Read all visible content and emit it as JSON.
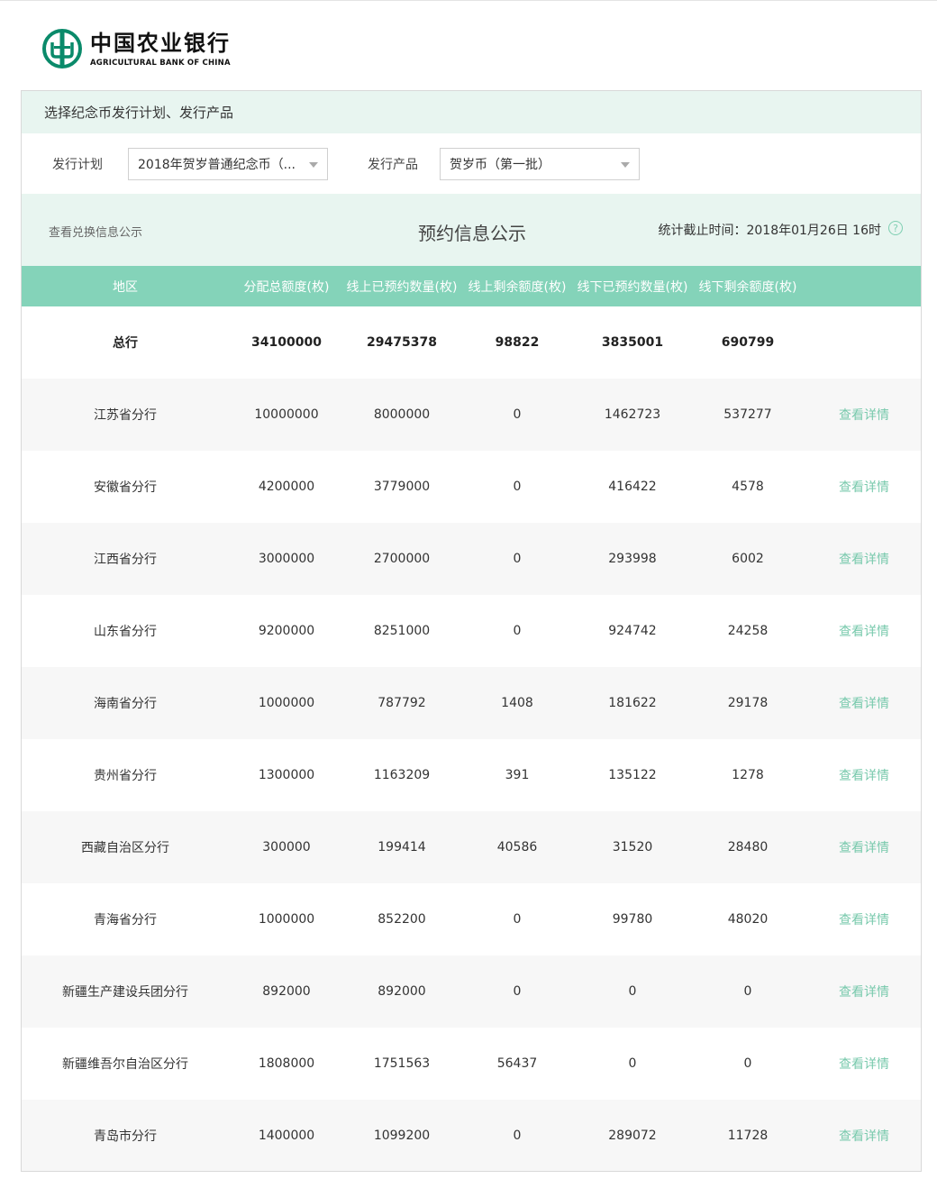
{
  "header": {
    "bank_name_cn": "中国农业银行",
    "bank_name_en": "AGRICULTURAL BANK OF CHINA",
    "brand_color": "#0a8a6a"
  },
  "panel": {
    "title": "选择纪念币发行计划、发行产品",
    "filters": {
      "plan_label": "发行计划",
      "plan_value": "2018年贺岁普通纪念币（...",
      "product_label": "发行产品",
      "product_value": "贺岁币（第一批）"
    },
    "info": {
      "exchange_link": "查看兑换信息公示",
      "title": "预约信息公示",
      "stat_time": "统计截止时间：2018年01月26日 16时",
      "help_icon": "question-circle-icon"
    }
  },
  "table": {
    "columns": [
      "地区",
      "分配总额度(枚)",
      "线上已预约数量(枚)",
      "线上剩余额度(枚)",
      "线下已预约数量(枚)",
      "线下剩余额度(枚)",
      ""
    ],
    "total": {
      "region": "总行",
      "values": [
        "34100000",
        "29475378",
        "98822",
        "3835001",
        "690799"
      ]
    },
    "detail_label": "查看详情",
    "rows": [
      {
        "region": "江苏省分行",
        "values": [
          "10000000",
          "8000000",
          "0",
          "1462723",
          "537277"
        ]
      },
      {
        "region": "安徽省分行",
        "values": [
          "4200000",
          "3779000",
          "0",
          "416422",
          "4578"
        ]
      },
      {
        "region": "江西省分行",
        "values": [
          "3000000",
          "2700000",
          "0",
          "293998",
          "6002"
        ]
      },
      {
        "region": "山东省分行",
        "values": [
          "9200000",
          "8251000",
          "0",
          "924742",
          "24258"
        ]
      },
      {
        "region": "海南省分行",
        "values": [
          "1000000",
          "787792",
          "1408",
          "181622",
          "29178"
        ]
      },
      {
        "region": "贵州省分行",
        "values": [
          "1300000",
          "1163209",
          "391",
          "135122",
          "1278"
        ]
      },
      {
        "region": "西藏自治区分行",
        "values": [
          "300000",
          "199414",
          "40586",
          "31520",
          "28480"
        ]
      },
      {
        "region": "青海省分行",
        "values": [
          "1000000",
          "852200",
          "0",
          "99780",
          "48020"
        ]
      },
      {
        "region": "新疆生产建设兵团分行",
        "values": [
          "892000",
          "892000",
          "0",
          "0",
          "0"
        ]
      },
      {
        "region": "新疆维吾尔自治区分行",
        "values": [
          "1808000",
          "1751563",
          "56437",
          "0",
          "0"
        ]
      },
      {
        "region": "青岛市分行",
        "values": [
          "1400000",
          "1099200",
          "0",
          "289072",
          "11728"
        ]
      }
    ]
  },
  "colors": {
    "header_green": "#84d3b9",
    "panel_tint": "#e8f5f0",
    "link_green": "#78c9ac"
  }
}
